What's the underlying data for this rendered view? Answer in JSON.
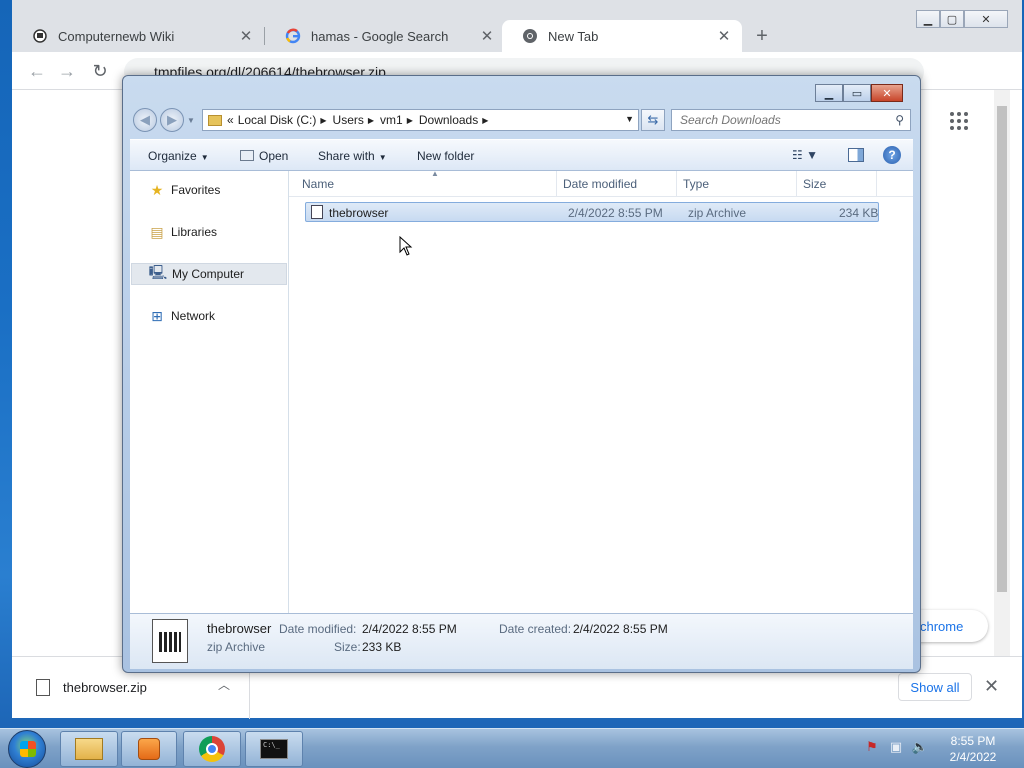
{
  "browser": {
    "tabs": [
      {
        "title": "Computernewb Wiki",
        "favicon": "computernewb-icon",
        "active": false
      },
      {
        "title": "hamas - Google Search",
        "favicon": "google-icon",
        "active": false
      },
      {
        "title": "New Tab",
        "favicon": "chrome-icon",
        "active": true
      }
    ],
    "url": "tmpfiles.org/dl/206614/thebrowser.zip",
    "chip_label": "chrome",
    "download": {
      "filename": "thebrowser.zip",
      "show_all_label": "Show all"
    }
  },
  "explorer": {
    "breadcrumb": [
      "Local Disk (C:)",
      "Users",
      "vm1",
      "Downloads"
    ],
    "breadcrumb_prefix": "«",
    "search_placeholder": "Search Downloads",
    "commands": {
      "organize": "Organize",
      "open": "Open",
      "share_with": "Share with",
      "new_folder": "New folder"
    },
    "nav_items": [
      {
        "label": "Favorites",
        "icon": "star-icon"
      },
      {
        "label": "Libraries",
        "icon": "libraries-icon"
      },
      {
        "label": "My Computer",
        "icon": "computer-icon",
        "selected": true
      },
      {
        "label": "Network",
        "icon": "network-icon"
      }
    ],
    "columns": [
      "Name",
      "Date modified",
      "Type",
      "Size"
    ],
    "files": [
      {
        "name": "thebrowser",
        "date_modified": "2/4/2022 8:55 PM",
        "type": "zip Archive",
        "size": "234 KB"
      }
    ],
    "details": {
      "name": "thebrowser",
      "type": "zip Archive",
      "date_modified_label": "Date modified:",
      "date_modified": "2/4/2022 8:55 PM",
      "date_created_label": "Date created:",
      "date_created": "2/4/2022 8:55 PM",
      "size_label": "Size:",
      "size": "233 KB"
    }
  },
  "taskbar": {
    "clock_time": "8:55 PM",
    "clock_date": "2/4/2022"
  }
}
